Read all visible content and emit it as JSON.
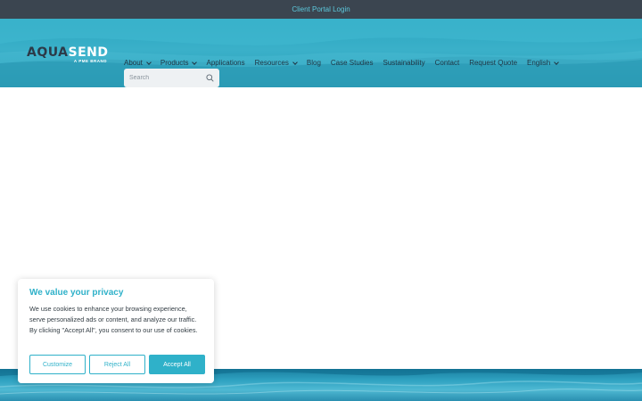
{
  "topbar": {
    "portal_link": "Client Portal Login"
  },
  "logo": {
    "main_dark": "AQUA",
    "main_light": "SEND",
    "sub": "A PME BRAND"
  },
  "nav": {
    "items": [
      {
        "label": "About",
        "dropdown": true
      },
      {
        "label": "Products",
        "dropdown": true
      },
      {
        "label": "Applications",
        "dropdown": false
      },
      {
        "label": "Resources",
        "dropdown": true
      },
      {
        "label": "Blog",
        "dropdown": false
      },
      {
        "label": "Case Studies",
        "dropdown": false
      },
      {
        "label": "Sustainability",
        "dropdown": false
      },
      {
        "label": "Contact",
        "dropdown": false
      },
      {
        "label": "Request Quote",
        "dropdown": false
      },
      {
        "label": "English",
        "dropdown": true
      }
    ]
  },
  "search": {
    "placeholder": "Search",
    "icon": "search-icon"
  },
  "cookie": {
    "title": "We value your privacy",
    "body": "We use cookies to enhance your browsing experience, serve personalized ads or content, and analyze our traffic. By clicking \"Accept All\", you consent to our use of cookies.",
    "customize_label": "Customize",
    "reject_label": "Reject All",
    "accept_label": "Accept All"
  },
  "colors": {
    "accent": "#2fb1c9",
    "topbar": "#3b4550",
    "header": "#3ab0c9",
    "nav_text": "#1f3442"
  }
}
